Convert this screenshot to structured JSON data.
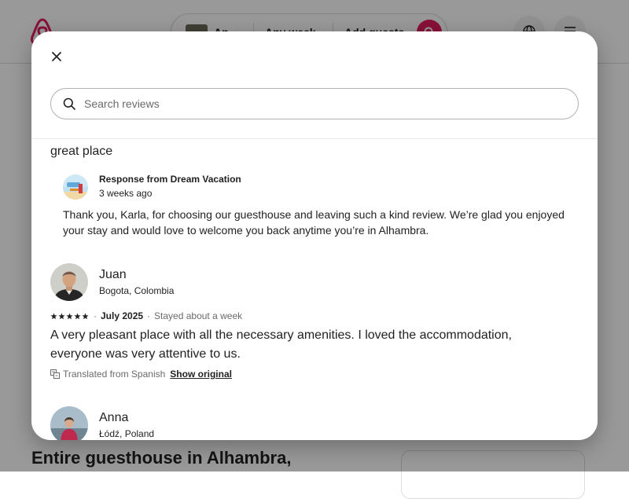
{
  "header": {
    "search": {
      "where": "An",
      "week": "Any week",
      "guests": "Add guests"
    }
  },
  "listing": {
    "title": "Entire guesthouse in Alhambra,"
  },
  "modal": {
    "close_icon": "close-icon",
    "search_placeholder": "Search reviews",
    "reviews": [
      {
        "text": "great place",
        "response": {
          "title": "Response from Dream Vacation",
          "time": "3 weeks ago",
          "text": "Thank you, Karla, for choosing our guesthouse and leaving such a kind review. We’re glad you enjoyed your stay and would love to welcome you back anytime you’re in Alhambra."
        }
      },
      {
        "name": "Juan",
        "location": "Bogota, Colombia",
        "rating": 5,
        "date": "July 2025",
        "stay": "Stayed about a week",
        "separator": "·",
        "text": "A very pleasant place with all the necessary amenities. I loved the accommodation, everyone was very attentive to us.",
        "translation_note": "Translated from Spanish",
        "show_original": "Show original"
      },
      {
        "name": "Anna",
        "location": "Łódź, Poland"
      }
    ]
  },
  "colors": {
    "brand": "#E31C5F",
    "text": "#222222",
    "muted": "#6A6A6A",
    "border": "#DDDDDD"
  }
}
